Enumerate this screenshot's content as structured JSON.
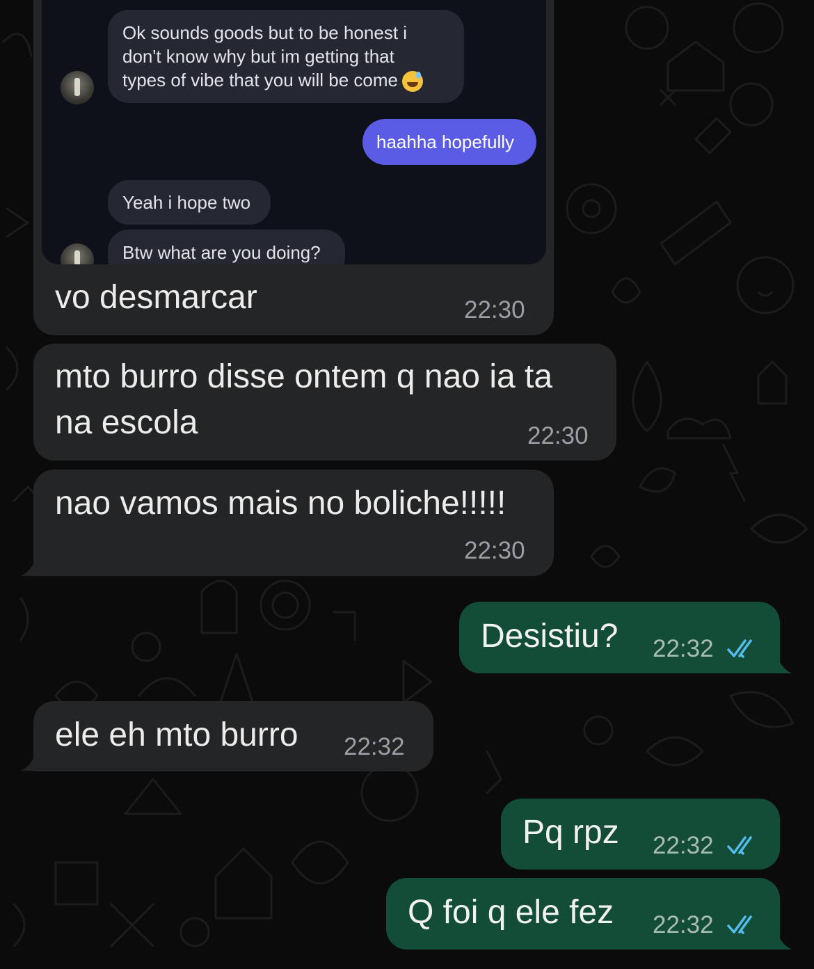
{
  "embedded_screenshot": {
    "messages": [
      {
        "direction": "incoming",
        "lines": [
          "Ok sounds goods but to be honest i",
          "don't know why but im getting that",
          "types of vibe that you will be come"
        ],
        "emoji": "sweat-smile-emoji"
      },
      {
        "direction": "outgoing",
        "text": "haahha hopefully"
      },
      {
        "direction": "incoming",
        "text": "Yeah i hope two"
      },
      {
        "direction": "incoming",
        "text": "Btw what are you doing?"
      }
    ]
  },
  "messages": [
    {
      "direction": "incoming",
      "text": "vo desmarcar",
      "time": "22:30"
    },
    {
      "direction": "incoming",
      "lines": [
        "mto burro disse ontem q nao ia ta",
        "na escola"
      ],
      "time": "22:30"
    },
    {
      "direction": "incoming",
      "text": "nao vamos mais no boliche!!!!!",
      "time": "22:30"
    },
    {
      "direction": "outgoing",
      "text": "Desistiu?",
      "time": "22:32",
      "status": "read"
    },
    {
      "direction": "incoming",
      "text": "ele eh mto burro",
      "time": "22:32"
    },
    {
      "direction": "outgoing",
      "text": "Pq rpz",
      "time": "22:32",
      "status": "read"
    },
    {
      "direction": "outgoing",
      "text": "Q foi q ele fez",
      "time": "22:32",
      "status": "read"
    }
  ],
  "colors": {
    "incoming_bubble": "#242526",
    "outgoing_bubble": "#144d37",
    "read_ticks": "#53bdeb",
    "background": "#0b0b0b"
  }
}
